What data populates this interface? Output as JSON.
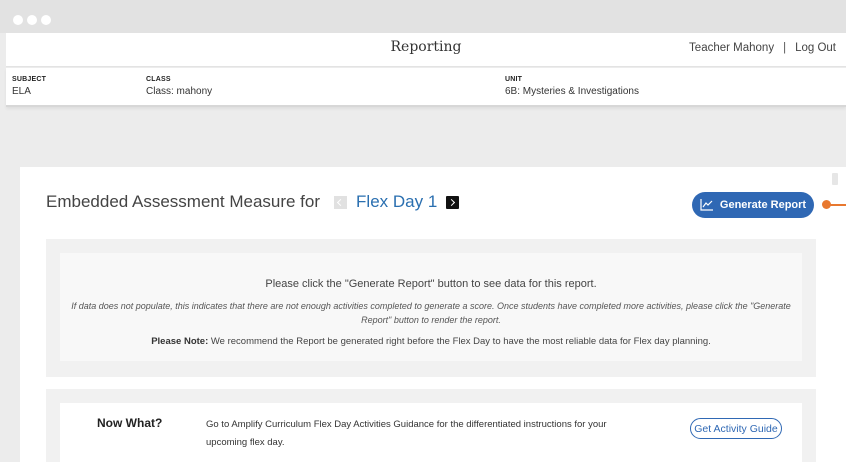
{
  "window": {
    "controls": [
      "close",
      "minimize",
      "maximize"
    ]
  },
  "header": {
    "title": "Reporting",
    "user": "Teacher Mahony",
    "separator": "|",
    "logout_label": "Log Out"
  },
  "filters": {
    "subject": {
      "label": "SUBJECT",
      "value": "ELA"
    },
    "class": {
      "label": "CLASS",
      "value": "Class: mahony"
    },
    "unit": {
      "label": "UNIT",
      "value": "6B: Mysteries & Investigations"
    }
  },
  "assessment": {
    "title": "Embedded Assessment Measure for",
    "current": "Flex Day 1",
    "prev_icon": "chevron-left-icon",
    "next_icon": "chevron-right-icon"
  },
  "generate_button": {
    "label": "Generate Report",
    "icon": "line-chart-icon",
    "color": "#2f68b4"
  },
  "annotation": {
    "color": "#e8782f"
  },
  "notice": {
    "line1": "Please click the \"Generate Report\" button to see data for this report.",
    "line2": "If data does not populate, this indicates that there are not enough activities completed to generate a score. Once students have completed more activities, please click the \"Generate Report\" button to render the report.",
    "note_label": "Please Note:",
    "note_text": " We recommend the Report be generated right before the Flex Day to have the most reliable data for Flex day planning."
  },
  "now_what": {
    "title": "Now What?",
    "text": "Go to Amplify Curriculum Flex Day Activities Guidance for the differentiated instructions for your upcoming flex day.",
    "button_label": "Get Activity Guide"
  }
}
